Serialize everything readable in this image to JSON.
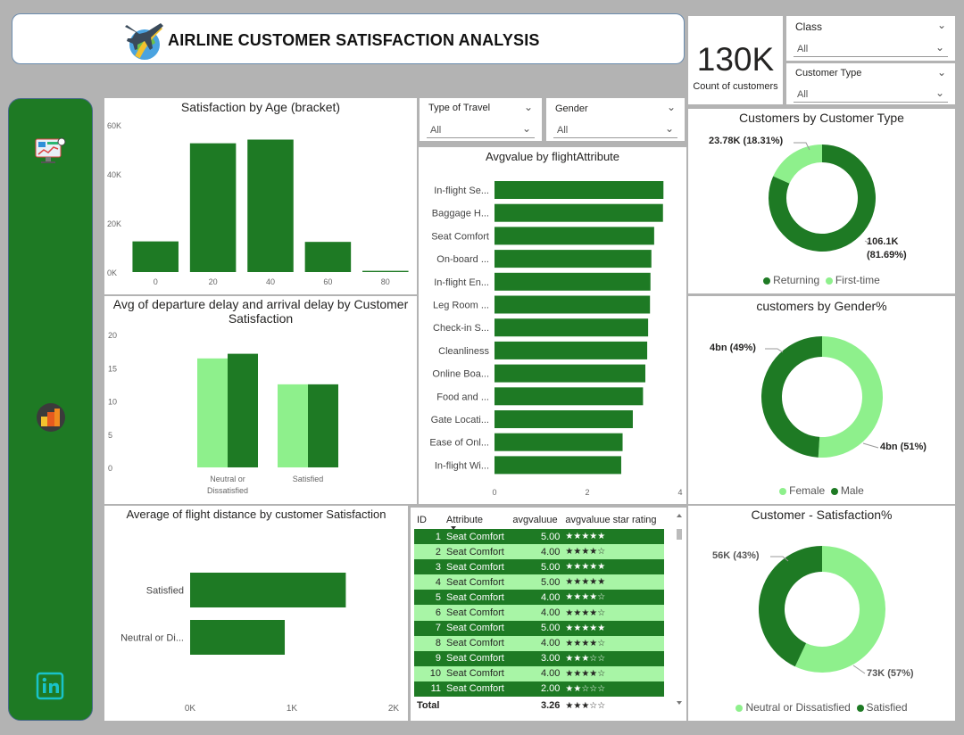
{
  "header": {
    "title": "AIRLINE CUSTOMER SATISFACTION ANALYSIS",
    "logo_icon": "airplane-globe-icon"
  },
  "sidebar": {
    "icons": [
      "dashboard-icon",
      "analytics-icon",
      "linkedin-icon"
    ]
  },
  "kpi": {
    "value": "130K",
    "label": "Count of customers"
  },
  "slicers": {
    "class": {
      "label": "Class",
      "value": "All"
    },
    "customer_type": {
      "label": "Customer Type",
      "value": "All"
    },
    "type_of_travel": {
      "label": "Type of Travel",
      "value": "All"
    },
    "gender": {
      "label": "Gender",
      "value": "All"
    }
  },
  "colors": {
    "dark_green": "#1e7a24",
    "light_green": "#8ef08c",
    "row_light": "#a8f5a6"
  },
  "age_chart": {
    "title": "Satisfaction by Age (bracket)",
    "yticks": [
      "60K",
      "40K",
      "20K",
      "0K"
    ],
    "xticks": [
      "0",
      "20",
      "40",
      "60",
      "80"
    ],
    "chart_data": {
      "type": "bar",
      "categories": [
        "0",
        "20",
        "40",
        "60",
        "80"
      ],
      "values": [
        12500,
        52500,
        54000,
        12300,
        500
      ],
      "ylim": [
        0,
        60000
      ]
    }
  },
  "delay_chart": {
    "title": "Avg of departure delay and arrival delay by Customer Satisfaction",
    "yticks": [
      "20",
      "15",
      "10",
      "5",
      "0"
    ],
    "categories_line1": [
      "Neutral or",
      "Satisfied"
    ],
    "categories_line2": [
      "Dissatisfied",
      ""
    ],
    "chart_data": {
      "type": "bar",
      "categories": [
        "Neutral or Dissatisfied",
        "Satisfied"
      ],
      "series": [
        {
          "values": [
            16.4,
            12.5
          ]
        },
        {
          "values": [
            17.1,
            12.5
          ]
        }
      ],
      "ylim": [
        0,
        20
      ]
    }
  },
  "distance_chart": {
    "title": "Average of flight distance by customer Satisfaction",
    "categories": [
      "Satisfied",
      "Neutral or Di..."
    ],
    "xticks": [
      "0K",
      "1K",
      "2K"
    ],
    "chart_data": {
      "type": "bar",
      "categories": [
        "Satisfied",
        "Neutral or Dissatisfied"
      ],
      "values": [
        1530,
        930
      ],
      "xlim": [
        0,
        2000
      ]
    }
  },
  "attr_chart": {
    "title": "Avgvalue by flightAttribute",
    "categories": [
      "In-flight Se...",
      "Baggage H...",
      "Seat Comfort",
      "On-board ...",
      "In-flight En...",
      "Leg Room ...",
      "Check-in S...",
      "Cleanliness",
      "Online Boa...",
      "Food and ...",
      "Gate Locati...",
      "Ease of Onl...",
      "In-flight Wi..."
    ],
    "xticks": [
      "0",
      "2",
      "4"
    ],
    "chart_data": {
      "type": "bar",
      "values": [
        3.64,
        3.63,
        3.44,
        3.38,
        3.36,
        3.35,
        3.31,
        3.29,
        3.25,
        3.2,
        2.98,
        2.76,
        2.73
      ],
      "xlim": [
        0,
        4
      ]
    }
  },
  "table": {
    "headers": [
      "ID",
      "Attribute",
      "avgvaluue",
      "avgvaluue star rating"
    ],
    "rows": [
      [
        "1",
        "Seat Comfort",
        "5.00",
        "★★★★★"
      ],
      [
        "2",
        "Seat Comfort",
        "4.00",
        "★★★★☆"
      ],
      [
        "3",
        "Seat Comfort",
        "5.00",
        "★★★★★"
      ],
      [
        "4",
        "Seat Comfort",
        "5.00",
        "★★★★★"
      ],
      [
        "5",
        "Seat Comfort",
        "4.00",
        "★★★★☆"
      ],
      [
        "6",
        "Seat Comfort",
        "4.00",
        "★★★★☆"
      ],
      [
        "7",
        "Seat Comfort",
        "5.00",
        "★★★★★"
      ],
      [
        "8",
        "Seat Comfort",
        "4.00",
        "★★★★☆"
      ],
      [
        "9",
        "Seat Comfort",
        "3.00",
        "★★★☆☆"
      ],
      [
        "10",
        "Seat Comfort",
        "4.00",
        "★★★★☆"
      ],
      [
        "11",
        "Seat Comfort",
        "2.00",
        "★★☆☆☆"
      ]
    ],
    "total": [
      "Total",
      "",
      "3.26",
      "★★★☆☆"
    ]
  },
  "donut_type": {
    "title": "Customers by Customer Type",
    "label_a": "23.78K (18.31%)",
    "label_b1": "106.1K",
    "label_b2": "(81.69%)",
    "legend": [
      "Returning",
      "First-time"
    ],
    "chart_data": {
      "type": "pie",
      "categories": [
        "Returning",
        "First-time"
      ],
      "values": [
        81.69,
        18.31
      ]
    }
  },
  "donut_gender": {
    "title": "customers by Gender%",
    "label_a": "4bn (49%)",
    "label_b": "4bn (51%)",
    "legend": [
      "Female",
      "Male"
    ],
    "chart_data": {
      "type": "pie",
      "categories": [
        "Female",
        "Male"
      ],
      "values": [
        51,
        49
      ]
    }
  },
  "donut_sat": {
    "title": "Customer - Satisfaction%",
    "label_a": "56K (43%)",
    "label_b": "73K (57%)",
    "legend": [
      "Neutral or Dissatisfied",
      "Satisfied"
    ],
    "chart_data": {
      "type": "pie",
      "categories": [
        "Satisfied",
        "Neutral or Dissatisfied"
      ],
      "values": [
        57,
        43
      ]
    }
  }
}
